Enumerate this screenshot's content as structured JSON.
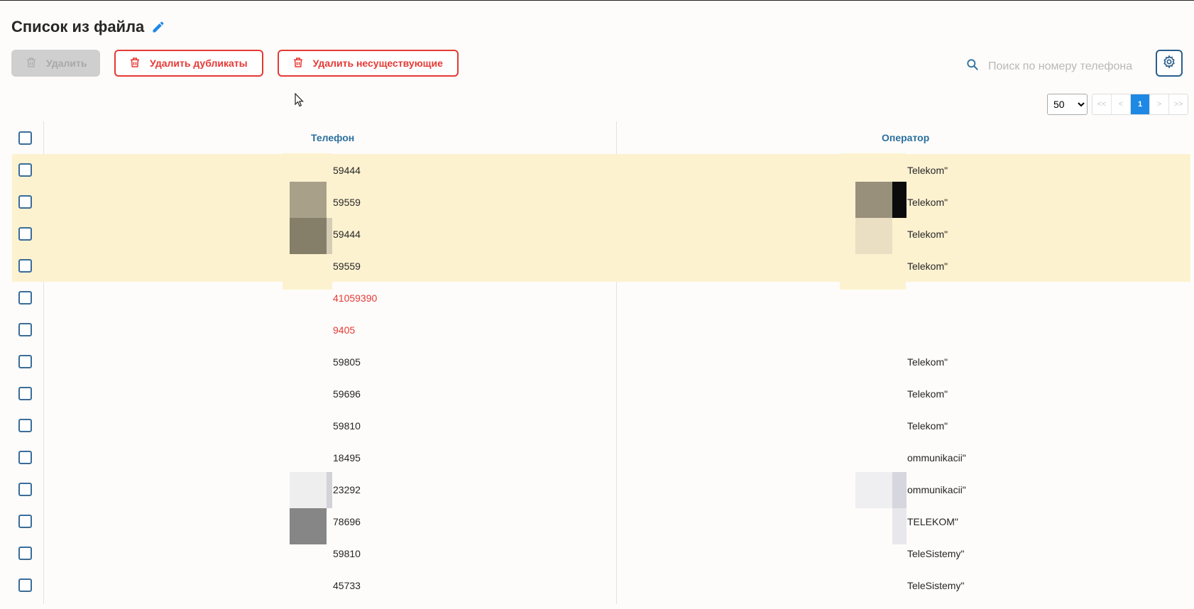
{
  "page": {
    "title": "Список из файла"
  },
  "toolbar": {
    "delete_label": "Удалить",
    "delete_duplicates_label": "Удалить дубликаты",
    "delete_nonexistent_label": "Удалить несуществующие"
  },
  "search": {
    "placeholder": "Поиск по номеру телефона",
    "value": ""
  },
  "pagination": {
    "page_size": "50",
    "page_size_options": [
      "50"
    ],
    "first": "<<",
    "prev": "<",
    "current": "1",
    "next": ">",
    "last": ">>"
  },
  "table": {
    "columns": {
      "phone": "Телефон",
      "operator": "Оператор"
    },
    "rows": [
      {
        "phone": "59444",
        "operator": "Telekom\"",
        "highlight": true,
        "invalid": false
      },
      {
        "phone": "59559",
        "operator": "Telekom\"",
        "highlight": true,
        "invalid": false
      },
      {
        "phone": "59444",
        "operator": "Telekom\"",
        "highlight": true,
        "invalid": false
      },
      {
        "phone": "59559",
        "operator": "Telekom\"",
        "highlight": true,
        "invalid": false
      },
      {
        "phone": "41059390",
        "operator": "",
        "highlight": false,
        "invalid": true
      },
      {
        "phone": "9405",
        "operator": "",
        "highlight": false,
        "invalid": true
      },
      {
        "phone": "59805",
        "operator": "Telekom\"",
        "highlight": false,
        "invalid": false
      },
      {
        "phone": "59696",
        "operator": "Telekom\"",
        "highlight": false,
        "invalid": false
      },
      {
        "phone": "59810",
        "operator": "Telekom\"",
        "highlight": false,
        "invalid": false
      },
      {
        "phone": "18495",
        "operator": "ommunikacii\"",
        "highlight": false,
        "invalid": false
      },
      {
        "phone": "23292",
        "operator": "ommunikacii\"",
        "highlight": false,
        "invalid": false
      },
      {
        "phone": "78696",
        "operator": "TELEKOM\"",
        "highlight": false,
        "invalid": false
      },
      {
        "phone": "59810",
        "operator": "TeleSistemy\"",
        "highlight": false,
        "invalid": false
      },
      {
        "phone": "45733",
        "operator": "TeleSistemy\"",
        "highlight": false,
        "invalid": false
      }
    ]
  },
  "colors": {
    "accent": "#1e88e5",
    "danger": "#e53935",
    "header_text": "#2a6f9e",
    "highlight_row": "#fdf2d0",
    "disabled_button": "#cfcfcf"
  },
  "icons": {
    "edit": "pencil-icon",
    "trash": "trash-icon",
    "search": "search-icon",
    "settings": "gear-icon"
  }
}
